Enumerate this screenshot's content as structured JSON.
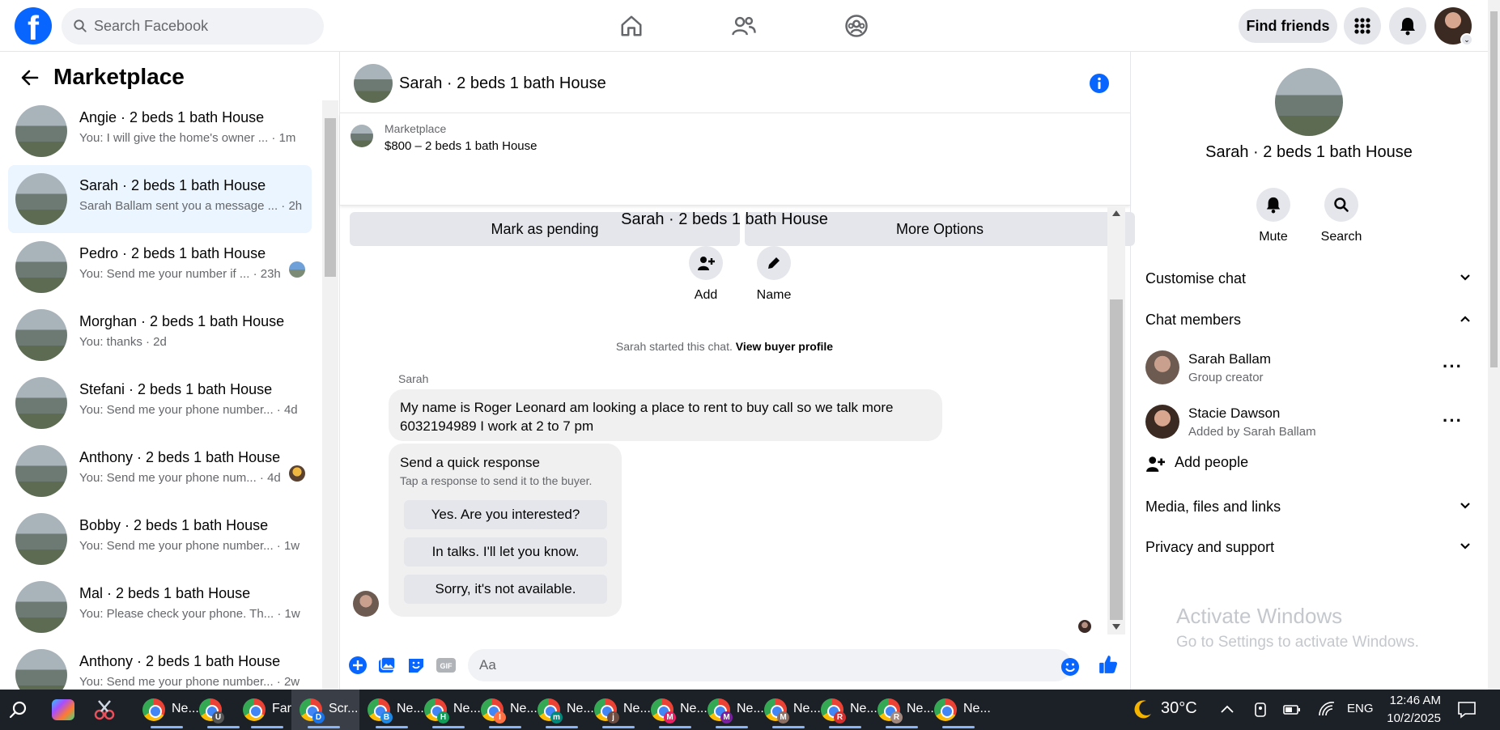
{
  "header": {
    "search_placeholder": "Search Facebook",
    "find_friends": "Find friends",
    "logo_letter": "f",
    "nav_icons": [
      "home-icon",
      "friends-icon",
      "groups-icon"
    ],
    "accent": "#0866ff"
  },
  "left": {
    "title": "Marketplace",
    "conversations": [
      {
        "name": "Angie · 2 beds 1 bath House",
        "msg": "You: I will give the home's owner ... · 1m",
        "active": false
      },
      {
        "name": "Sarah · 2 beds 1 bath House",
        "msg": "Sarah Ballam sent you a message ... · 2h",
        "active": true
      },
      {
        "name": "Pedro · 2 beds 1 bath House",
        "msg": "You: Send me your number if ... · 23h",
        "active": false
      },
      {
        "name": "Morghan · 2 beds 1 bath House",
        "msg": "You: thanks · 2d",
        "active": false
      },
      {
        "name": "Stefani · 2 beds 1 bath House",
        "msg": "You: Send me your phone number... · 4d",
        "active": false
      },
      {
        "name": "Anthony · 2 beds 1 bath House",
        "msg": "You: Send me your phone num... · 4d",
        "active": false
      },
      {
        "name": "Bobby · 2 beds 1 bath House",
        "msg": "You: Send me your phone number... · 1w",
        "active": false
      },
      {
        "name": "Mal · 2 beds 1 bath House",
        "msg": "You: Please check your phone. Th... · 1w",
        "active": false
      },
      {
        "name": "Anthony · 2 beds 1 bath House",
        "msg": "You: Send me your phone number... · 2w",
        "active": false
      }
    ]
  },
  "chat": {
    "title": "Sarah · 2 beds 1 bath House",
    "listing_label": "Marketplace",
    "listing_price": "$800 – 2 beds 1 bath House",
    "mark_pending": "Mark as pending",
    "more_options": "More Options",
    "center_title": "Sarah · 2 beds 1 bath House",
    "add_label": "Add",
    "name_label": "Name",
    "started_text": "Sarah started this chat.",
    "view_profile": "View buyer profile",
    "sender": "Sarah",
    "message": "My name is  Roger Leonard am looking a place to rent to buy call so we talk more 6032194989 I work at 2 to 7 pm",
    "quick_title": "Send a quick response",
    "quick_sub": "Tap a response to send it to the buyer.",
    "quick_replies": [
      "Yes. Are you interested?",
      "In talks. I'll let you know.",
      "Sorry, it's not available."
    ],
    "input_placeholder": "Aa"
  },
  "right": {
    "title": "Sarah · 2 beds 1 bath House",
    "mute": "Mute",
    "search": "Search",
    "customise": "Customise chat",
    "members_header": "Chat members",
    "members": [
      {
        "name": "Sarah Ballam",
        "sub": "Group creator"
      },
      {
        "name": "Stacie Dawson",
        "sub": "Added by Sarah Ballam"
      }
    ],
    "add_people": "Add people",
    "media": "Media, files and links",
    "privacy": "Privacy and support",
    "activate_1": "Activate Windows",
    "activate_2": "Go to Settings to activate Windows."
  },
  "taskbar": {
    "apps": [
      {
        "label": "Ne...",
        "badge": ""
      },
      {
        "label": "",
        "badge": "U"
      },
      {
        "label": "Far...",
        "badge": ""
      },
      {
        "label": "Scr...",
        "badge": "D"
      },
      {
        "label": "Ne...",
        "badge": "B"
      },
      {
        "label": "Ne...",
        "badge": "H"
      },
      {
        "label": "Ne...",
        "badge": "I"
      },
      {
        "label": "Ne...",
        "badge": "m"
      },
      {
        "label": "Ne...",
        "badge": "j"
      },
      {
        "label": "Ne...",
        "badge": "M"
      },
      {
        "label": "Ne...",
        "badge": "M"
      },
      {
        "label": "Ne...",
        "badge": "M"
      },
      {
        "label": "Ne...",
        "badge": "R"
      },
      {
        "label": "Ne...",
        "badge": "R"
      },
      {
        "label": "Ne...",
        "badge": ""
      }
    ],
    "temperature": "30°C",
    "language": "ENG",
    "time": "12:46 AM",
    "date": "10/2/2025"
  }
}
